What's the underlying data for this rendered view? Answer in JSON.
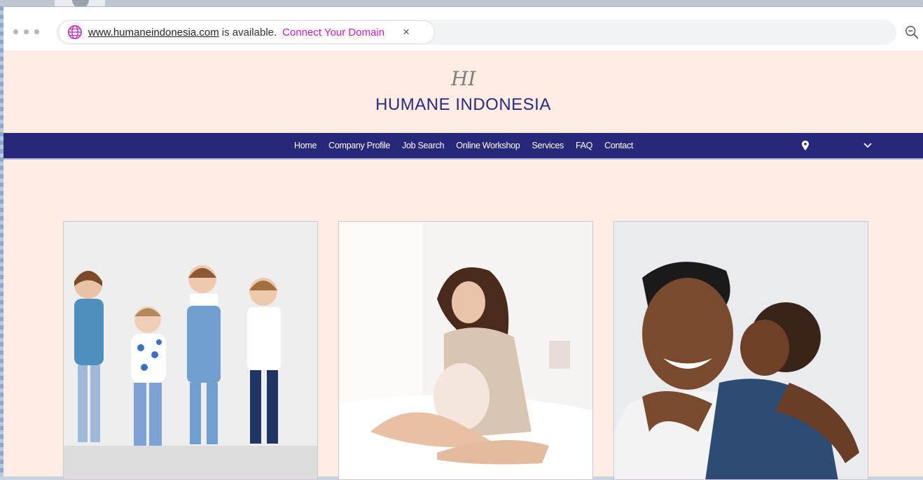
{
  "browser": {
    "domain_link": "www.humaneindonesia.com",
    "domain_status": "is available.",
    "connect_label": "Connect Your Domain",
    "close_symbol": "×"
  },
  "site": {
    "logo_mark": "HI",
    "title": "HUMANE INDONESIA",
    "nav": {
      "items": [
        "Home",
        "Company Profile",
        "Job Search",
        "Online Workshop",
        "Services",
        "FAQ",
        "Contact"
      ]
    }
  },
  "colors": {
    "site_bg": "#fdece3",
    "nav_bg": "#28287a",
    "title": "#2a2a7c",
    "connect_link": "#c01dc0"
  },
  "icons": [
    "globe-icon",
    "close-icon",
    "zoom-out-icon",
    "location-pin-icon",
    "chevron-down-icon"
  ],
  "gallery": {
    "images": [
      "children-photo",
      "pregnant-woman-photo",
      "father-and-son-photo"
    ]
  }
}
